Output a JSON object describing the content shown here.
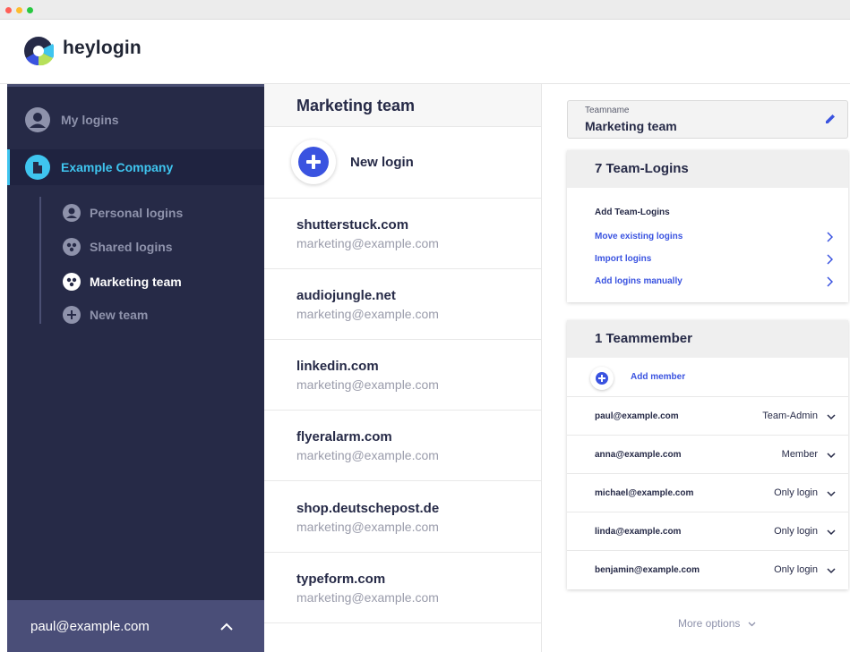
{
  "app": {
    "brand": "heylogin"
  },
  "sidebar": {
    "items": [
      {
        "label": "My logins",
        "icon": "user-icon"
      },
      {
        "label": "Example Company",
        "icon": "building-icon"
      }
    ],
    "subitems": [
      {
        "label": "Personal logins",
        "icon": "user-icon"
      },
      {
        "label": "Shared logins",
        "icon": "group-icon"
      },
      {
        "label": "Marketing team",
        "icon": "group-icon"
      },
      {
        "label": "New team",
        "icon": "plus-icon"
      }
    ],
    "user_email": "paul@example.com"
  },
  "middle": {
    "title": "Marketing team",
    "new_login_label": "New login",
    "logins": [
      {
        "domain": "shutterstuck.com",
        "user": "marketing@example.com"
      },
      {
        "domain": "audiojungle.net",
        "user": "marketing@example.com"
      },
      {
        "domain": "linkedin.com",
        "user": "marketing@example.com"
      },
      {
        "domain": "flyeralarm.com",
        "user": "marketing@example.com"
      },
      {
        "domain": "shop.deutschepost.de",
        "user": "marketing@example.com"
      },
      {
        "domain": "typeform.com",
        "user": "marketing@example.com"
      }
    ]
  },
  "right": {
    "teamname_caption": "Teamname",
    "teamname_value": "Marketing team",
    "team_logins": {
      "heading": "7 Team-Logins",
      "sub_heading": "Add Team-Logins",
      "links": [
        "Move existing logins",
        "Import logins",
        "Add logins manually"
      ]
    },
    "members": {
      "heading": "1 Teammember",
      "add_label": "Add member",
      "rows": [
        {
          "email": "paul@example.com",
          "role": "Team-Admin"
        },
        {
          "email": "anna@example.com",
          "role": "Member"
        },
        {
          "email": "michael@example.com",
          "role": "Only login"
        },
        {
          "email": "linda@example.com",
          "role": "Only login"
        },
        {
          "email": "benjamin@example.com",
          "role": "Only login"
        }
      ]
    },
    "more_options": "More options"
  },
  "colors": {
    "sidebar_bg": "#262a47",
    "accent_cyan": "#3fc5ef",
    "accent_blue": "#3a53e0",
    "userbar_bg": "#4a4e78"
  }
}
